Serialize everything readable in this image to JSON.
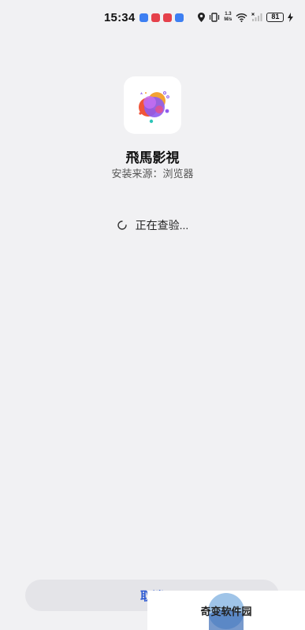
{
  "status_bar": {
    "time": "15:34",
    "network_speed_value": "1.3",
    "network_speed_unit": "M/s",
    "battery_level": "81",
    "notification_icons": [
      "app-notification-icon",
      "app-notification-icon",
      "app-notification-icon",
      "app-notification-icon"
    ],
    "colors": {
      "blue": "#3d7ff2",
      "red": "#e5414b"
    }
  },
  "app": {
    "name": "飛馬影視",
    "install_source": "安装来源：浏览器",
    "icon": "app-logo-icon"
  },
  "progress": {
    "status_text": "正在查验...",
    "icon": "loading-spinner-icon"
  },
  "actions": {
    "cancel_label": "取消",
    "accent_color": "#2f5bd3"
  },
  "watermark": {
    "text": "奇变软件园"
  }
}
